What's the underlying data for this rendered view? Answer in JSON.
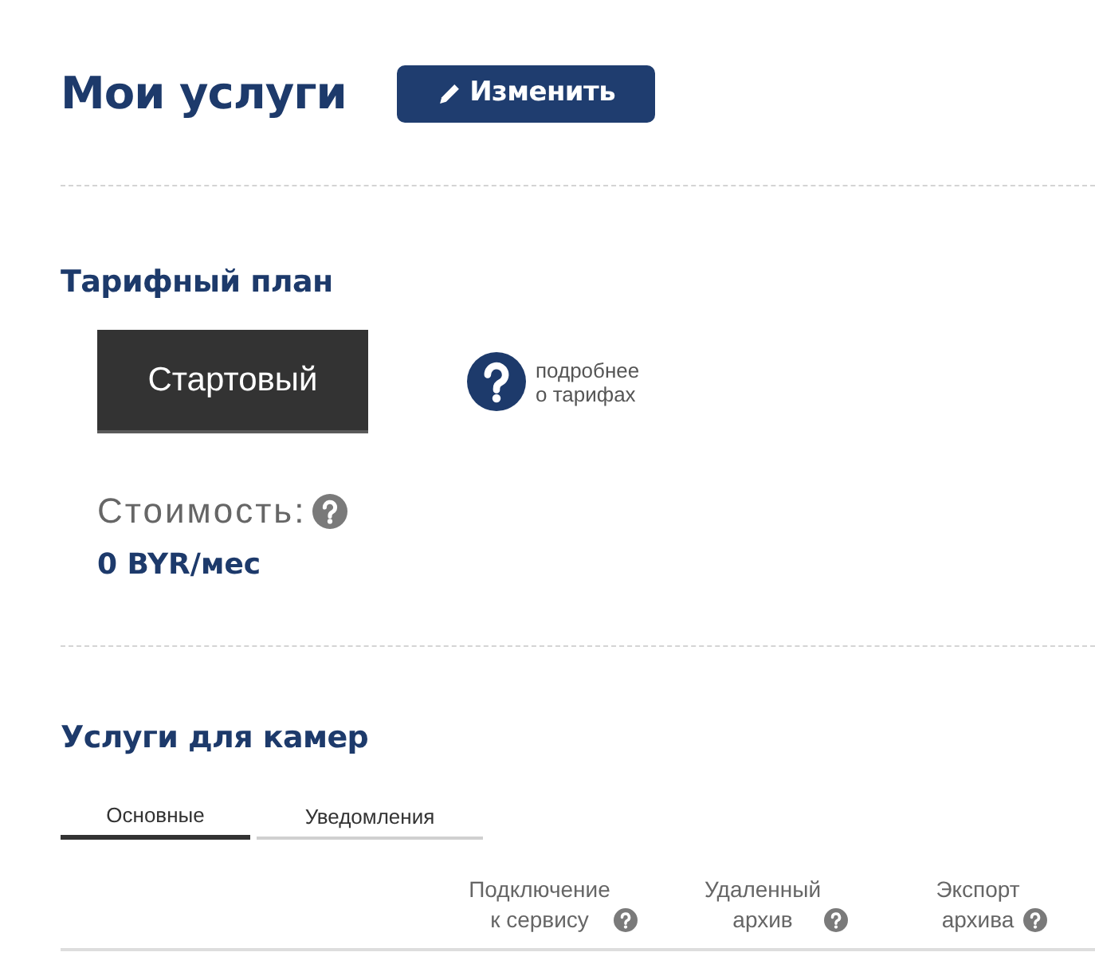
{
  "page_title": "Мои услуги",
  "edit_button": {
    "label": "Изменить"
  },
  "tariff_plan": {
    "heading": "Тарифный план",
    "plan_name": "Стартовый",
    "more_link": "подробнее\nо тарифах",
    "cost_label": "Стоимость:",
    "cost_value": "0 BYR/мес"
  },
  "camera_services": {
    "heading": "Услуги для камер",
    "tabs": [
      {
        "label": "Основные",
        "selected": true
      },
      {
        "label": "Уведомления",
        "selected": false
      }
    ],
    "columns": [
      "Подключение\nк сервису",
      "Удаленный\nархив",
      "Экспорт\nархива"
    ]
  }
}
